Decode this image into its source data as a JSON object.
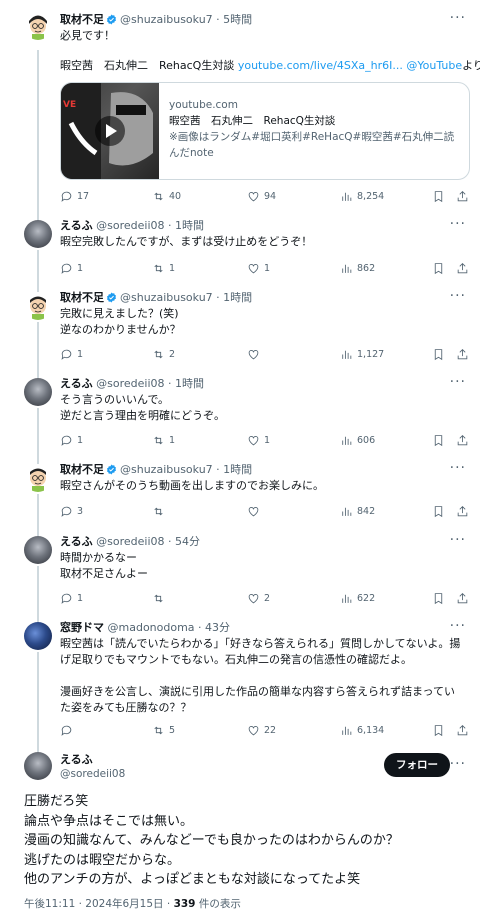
{
  "tweets": [
    {
      "name": "取材不足",
      "handle": "@shuzaibusoku7",
      "time": "5時間",
      "verified": true,
      "text": "必見です！",
      "line2_plain": "暇空茜　石丸伸二　RehacQ生対談 ",
      "line2_link": "youtube.com/live/4SXa_hr6I...",
      "line2_link2": " @YouTube",
      "line2_suffix": "より",
      "card": {
        "domain": "youtube.com",
        "title": "暇空茜　石丸伸二　RehacQ生対談",
        "desc": "※画像はランダム#堀口英利#ReHacQ#暇空茜#石丸伸二読んだnote"
      },
      "replies": "17",
      "retweets": "40",
      "likes": "94",
      "views": "8,254"
    },
    {
      "name": "えるふ",
      "handle": "@soredeii08",
      "time": "1時間",
      "text": "暇空完敗したんですが、まずは受け止めをどうぞ！",
      "replies": "1",
      "retweets": "1",
      "likes": "1",
      "views": "862"
    },
    {
      "name": "取材不足",
      "handle": "@shuzaibusoku7",
      "time": "1時間",
      "verified": true,
      "text": "完敗に見えました？(笑)\n逆なのわかりませんか？",
      "replies": "1",
      "retweets": "2",
      "likes": "",
      "views": "1,127"
    },
    {
      "name": "えるふ",
      "handle": "@soredeii08",
      "time": "1時間",
      "text": "そう言うのいいんで。\n逆だと言う理由を明確にどうぞ。",
      "replies": "1",
      "retweets": "1",
      "likes": "1",
      "views": "606"
    },
    {
      "name": "取材不足",
      "handle": "@shuzaibusoku7",
      "time": "1時間",
      "verified": true,
      "text": "暇空さんがそのうち動画を出しますのでお楽しみに。",
      "replies": "3",
      "retweets": "",
      "likes": "",
      "views": "842"
    },
    {
      "name": "えるふ",
      "handle": "@soredeii08",
      "time": "54分",
      "text": "時間かかるなー\n取材不足さんよー",
      "replies": "1",
      "retweets": "",
      "likes": "2",
      "views": "622"
    },
    {
      "name": "窓野ドマ",
      "handle": "@madonodoma",
      "time": "43分",
      "text": "暇空茜は「読んでいたらわかる」「好きなら答えられる」質問しかしてないよ。揚げ足取りでもマウントでもない。石丸伸二の発言の信憑性の確認だよ。\n\n漫画好きを公言し、演説に引用した作品の簡単な内容すら答えられず詰まっていた姿をみても圧勝なの？？",
      "replies": "",
      "retweets": "5",
      "likes": "22",
      "views": "6,134"
    }
  ],
  "main": {
    "name": "えるふ",
    "handle": "@soredeii08",
    "follow_label": "フォロー",
    "text": "圧勝だろ笑\n論点や争点はそこでは無い。\n漫画の知識なんて、みんなどーでも良かったのはわからんのか？\n逃げたのは暇空だからな。\n他のアンチの方が、よっぽどまともな対談になってたよ笑",
    "time": "午後11:11",
    "date": "2024年6月15日",
    "views_count": "339",
    "views_label": " 件の表示"
  },
  "colors": {
    "accent": "#1d9bf0",
    "text": "#0f1419",
    "muted": "#536471",
    "border": "#cfd9de"
  },
  "icons": [
    "reply-icon",
    "retweet-icon",
    "like-icon",
    "views-icon",
    "bookmark-icon",
    "share-icon",
    "verified-icon",
    "more-icon",
    "play-icon"
  ]
}
